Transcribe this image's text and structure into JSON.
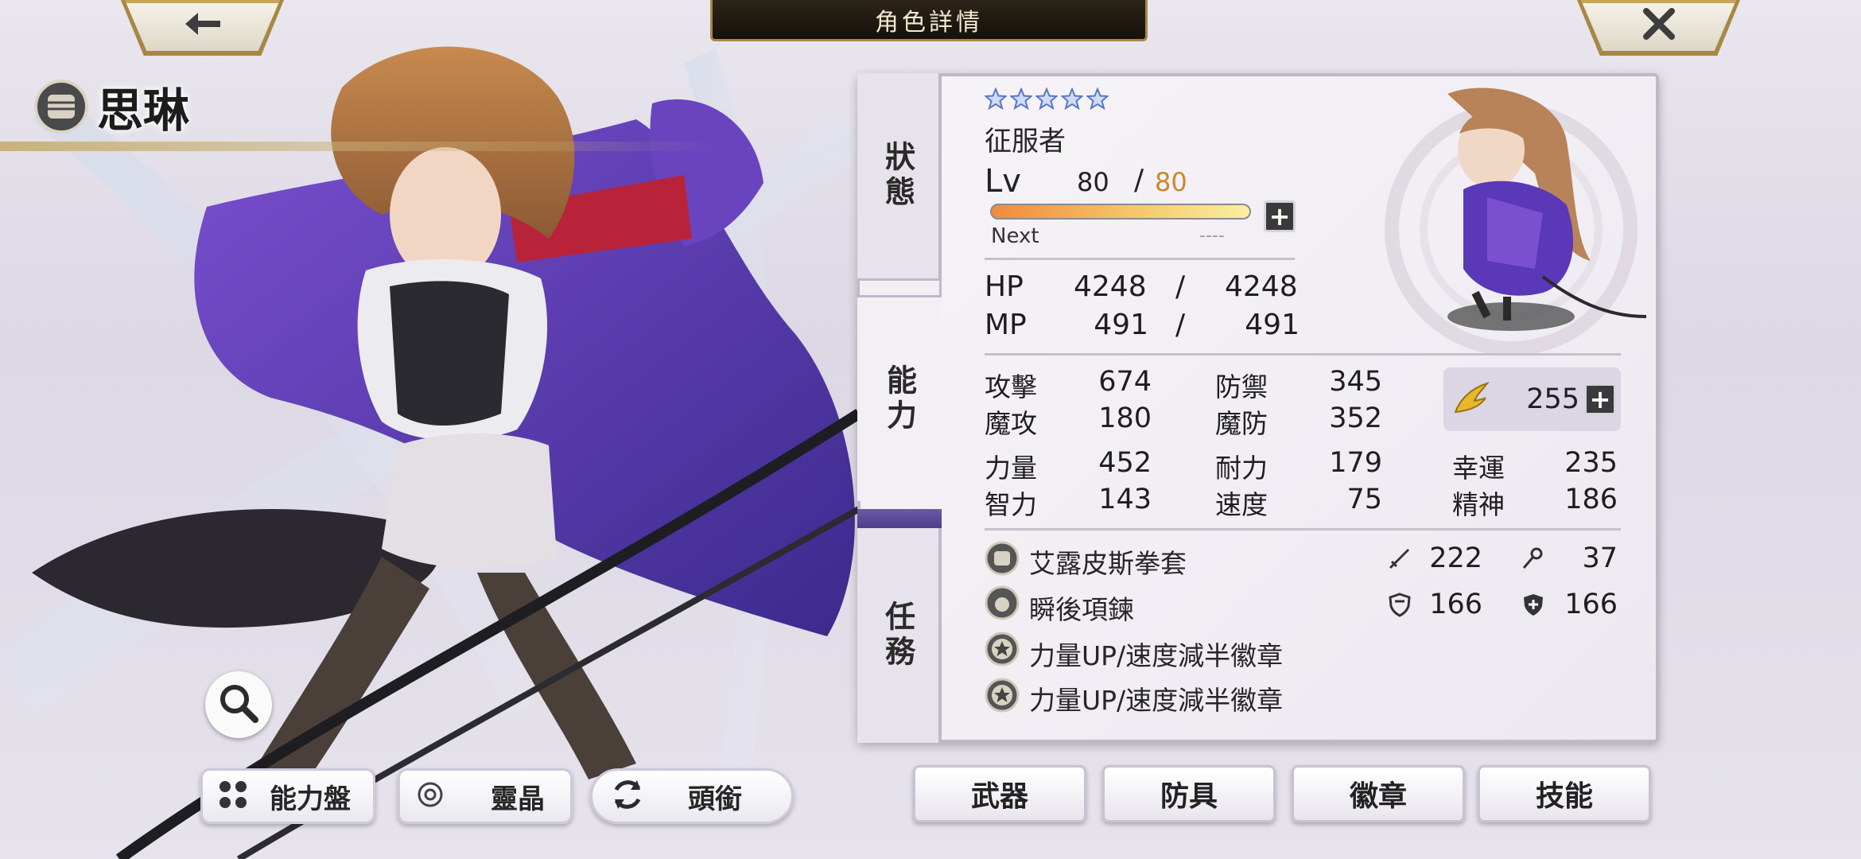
{
  "header": {
    "title": "角色詳情",
    "back_icon": "back-arrow-icon",
    "close_icon": "close-icon"
  },
  "character": {
    "name": "思琳",
    "job_icon": "fist-icon",
    "rarity_stars": 5,
    "job": "征服者",
    "level_label": "Lv",
    "level": "80",
    "level_slash": "/",
    "level_max": "80",
    "next_label": "Next",
    "next_value": "----",
    "exp_fraction": 0.95
  },
  "tabs": [
    {
      "label": "狀態",
      "active": false
    },
    {
      "label": "能力",
      "active": true
    },
    {
      "label": "任務",
      "active": false
    }
  ],
  "vitals": {
    "hp_label": "HP",
    "hp": "4248",
    "hp_sep": "/",
    "hp_max": "4248",
    "mp_label": "MP",
    "mp": "491",
    "mp_sep": "/",
    "mp_max": "491"
  },
  "stats": {
    "atk_label": "攻擊",
    "atk": "674",
    "def_label": "防禦",
    "def": "345",
    "matk_label": "魔攻",
    "matk": "180",
    "mdef_label": "魔防",
    "mdef": "352",
    "str_label": "力量",
    "str": "452",
    "vit_label": "耐力",
    "vit": "179",
    "luck_label": "幸運",
    "luck": "235",
    "int_label": "智力",
    "int": "143",
    "spd_label": "速度",
    "spd": "75",
    "spi_label": "精神",
    "spi": "186",
    "ether_icon": "golden-wing-icon",
    "ether_value": "255"
  },
  "equipment": [
    {
      "icon": "fist-weapon-icon",
      "name": "艾露皮斯拳套",
      "stat1_icon": "sword-icon",
      "stat1": "222",
      "stat2_icon": "staff-icon",
      "stat2": "37"
    },
    {
      "icon": "necklace-icon",
      "name": "瞬後項鍊",
      "stat1_icon": "shield-icon",
      "stat1": "166",
      "stat2_icon": "magic-shield-icon",
      "stat2": "166"
    },
    {
      "icon": "badge-star-icon",
      "name": "力量UP/速度減半徽章"
    },
    {
      "icon": "badge-star-icon",
      "name": "力量UP/速度減半徽章"
    }
  ],
  "bottom_left_buttons": [
    {
      "label": "能力盤",
      "icon": "ability-board-icon"
    },
    {
      "label": "靈晶",
      "icon": "crystal-icon"
    },
    {
      "label": "頭銜",
      "icon": "refresh-icon"
    }
  ],
  "bottom_right_buttons": [
    {
      "label": "武器"
    },
    {
      "label": "防具"
    },
    {
      "label": "徽章"
    },
    {
      "label": "技能"
    }
  ],
  "colors": {
    "accent_gold": "#a88746",
    "title_bar": "#1c160e",
    "level_max": "#c8892b",
    "tab_separator": "#5a4a9a"
  }
}
